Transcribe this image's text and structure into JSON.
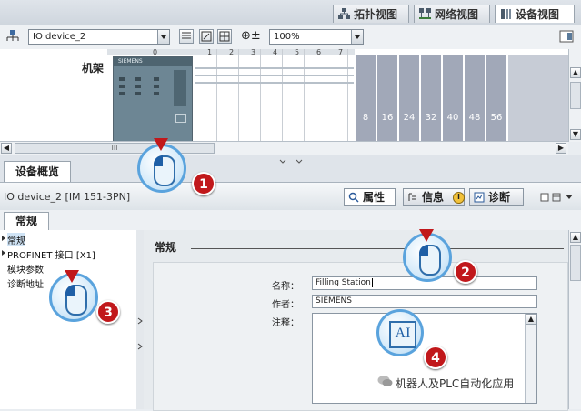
{
  "view_tabs": [
    {
      "label": "拓扑视图",
      "icon": "topology-icon",
      "active": false
    },
    {
      "label": "网络视图",
      "icon": "network-icon",
      "active": false
    },
    {
      "label": "设备视图",
      "icon": "device-icon",
      "active": true
    }
  ],
  "toolbar": {
    "device_select": "IO device_2",
    "zoom": "100%"
  },
  "canvas": {
    "rack_label": "机架",
    "slot_numbers": [
      "0",
      "1",
      "2",
      "3",
      "4",
      "5",
      "6",
      "7"
    ],
    "module_brand": "SIEMENS",
    "extra_slots": [
      "8",
      "16",
      "24",
      "32",
      "40",
      "48",
      "56"
    ]
  },
  "hscroll_thumb": "III",
  "overview_tab": "设备概览",
  "inspector": {
    "title": "IO device_2 [IM 151-3PN]",
    "tabs": [
      {
        "label": "属性",
        "active": true
      },
      {
        "label": "信息",
        "active": false
      },
      {
        "label": "诊断",
        "active": false
      }
    ],
    "sub_tab": "常规",
    "nav_items": [
      {
        "label": "常规",
        "expandable": true,
        "selected": true
      },
      {
        "label": "PROFINET 接口 [X1]",
        "expandable": true,
        "selected": false
      },
      {
        "label": "模块参数",
        "expandable": false,
        "selected": false
      },
      {
        "label": "诊断地址",
        "expandable": false,
        "selected": false
      }
    ],
    "section_title": "常规",
    "fields": {
      "name_label": "名称：",
      "name_value": "Filling Station",
      "author_label": "作者：",
      "author_value": "SIEMENS",
      "comment_label": "注释："
    }
  },
  "callouts": [
    "1",
    "2",
    "3",
    "4"
  ],
  "ai_icon_text": "AI",
  "watermark": "机器人及PLC自动化应用",
  "colors": {
    "callout_red": "#c1181b",
    "callout_blue": "#5aa3dd",
    "module_body": "#6d8694",
    "empty_slot": "#a1a8b8"
  }
}
